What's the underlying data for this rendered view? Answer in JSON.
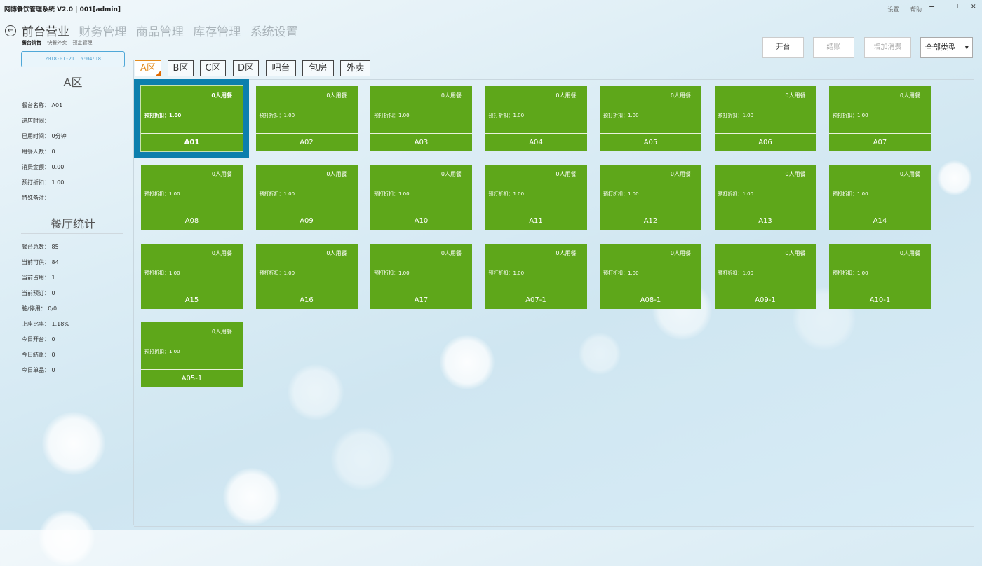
{
  "window": {
    "title": "网博餐饮管理系统 V2.0 | 001[admin]",
    "links": [
      "设置",
      "帮助"
    ],
    "controls": {
      "minimize": "−",
      "restore": "❐",
      "close": "✕"
    }
  },
  "nav": {
    "back_icon": "←",
    "items": [
      "前台营业",
      "财务管理",
      "商品管理",
      "库存管理",
      "系统设置"
    ],
    "active_index": 0,
    "sub_items": [
      "餐台销售",
      "快餐外卖",
      "预定管理"
    ],
    "sub_active_index": 0
  },
  "sidebar": {
    "datetime": "2018-01-21 16:04:18",
    "area_title": "A区",
    "table_info": [
      "餐台名称： A01",
      "进店时间：",
      "已用时间： 0分钟",
      "用餐人数： 0",
      "消费金额： 0.00",
      "预打折扣： 1.00",
      "特殊备注："
    ],
    "stats_title": "餐厅统计",
    "stats": [
      "餐台总数： 85",
      "当前可供： 84",
      "当前占用： 1",
      "当前预订： 0",
      "脏/停用：  0/0",
      "上座比率： 1.18%",
      "今日开台： 0",
      "今日結账： 0",
      "今日单品： 0"
    ]
  },
  "area_tabs": [
    "A区",
    "B区",
    "C区",
    "D区",
    "吧台",
    "包房",
    "外卖"
  ],
  "area_active_index": 0,
  "actions": {
    "open_label": "开台",
    "checkout_label": "结账",
    "add_label": "增加消费",
    "type_select": "全部类型",
    "select_arrow": "▼"
  },
  "card_defaults": {
    "persons": "0人用餐",
    "discount": "预打折扣：1.00"
  },
  "tables": [
    "A01",
    "A02",
    "A03",
    "A04",
    "A05",
    "A06",
    "A07",
    "A08",
    "A09",
    "A10",
    "A11",
    "A12",
    "A13",
    "A14",
    "A15",
    "A16",
    "A17",
    "A07-1",
    "A08-1",
    "A09-1",
    "A10-1",
    "A05-1"
  ],
  "selected_table": "A01",
  "colors": {
    "card": "#5ea71a",
    "selected_frame": "#0d7fad",
    "active_tab": "#e38c1e"
  }
}
